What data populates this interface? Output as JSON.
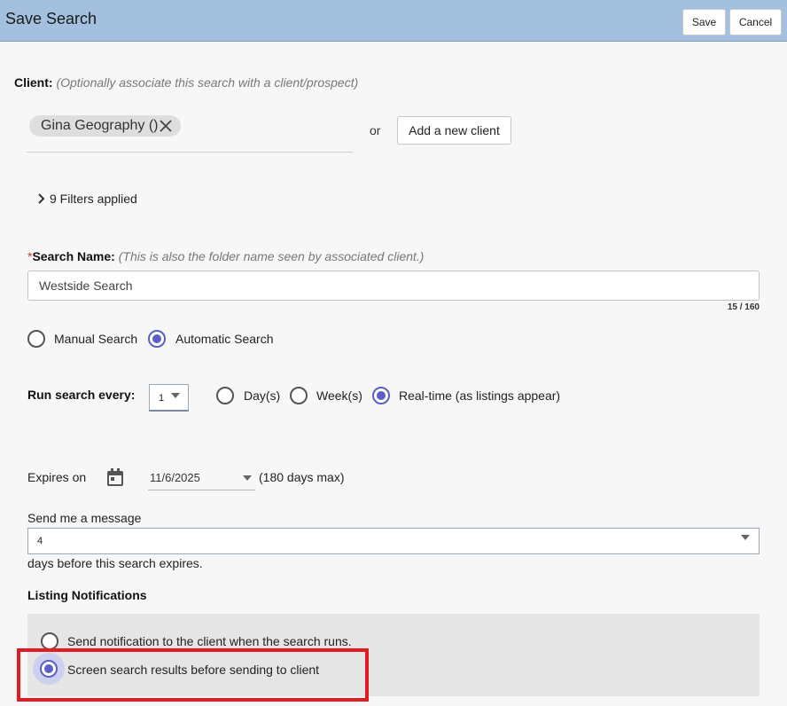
{
  "header": {
    "title": "Save Search",
    "save_label": "Save",
    "cancel_label": "Cancel"
  },
  "client": {
    "label": "Client:",
    "hint": "(Optionally associate this search with a client/prospect)",
    "chip": "Gina Geography ()",
    "or_text": "or",
    "add_button": "Add a new client"
  },
  "filters": {
    "label": "9 Filters applied"
  },
  "search_name": {
    "required_mark": "*",
    "label": "Search Name:",
    "hint": "(This is also the folder name seen by associated client.)",
    "value": "Westside Search",
    "counter": "15 / 160"
  },
  "search_type": {
    "options": [
      {
        "label": "Manual Search",
        "selected": false
      },
      {
        "label": "Automatic Search",
        "selected": true
      }
    ]
  },
  "run": {
    "label": "Run search every:",
    "value": "1",
    "options": [
      {
        "label": "Day(s)",
        "selected": false
      },
      {
        "label": "Week(s)",
        "selected": false
      },
      {
        "label": "Real-time (as listings appear)",
        "selected": true
      }
    ]
  },
  "expires": {
    "label": "Expires on",
    "date": "11/6/2025",
    "max_note": "(180 days max)"
  },
  "message": {
    "label": "Send me a message",
    "value": "4",
    "suffix": "days before this search expires."
  },
  "notifications": {
    "title": "Listing Notifications",
    "options": [
      {
        "label": "Send notification to the client when the search runs.",
        "selected": false
      },
      {
        "label": "Screen search results before sending to client",
        "selected": true
      }
    ]
  },
  "colors": {
    "header_bg": "#a3c1df",
    "accent": "#5b5fc7",
    "highlight": "#e01b24",
    "required": "#c0392b"
  },
  "icons": {
    "chip_remove": "close-icon",
    "filters_toggle": "chevron-right-icon",
    "date_picker": "calendar-icon",
    "dropdown": "caret-down-icon"
  }
}
